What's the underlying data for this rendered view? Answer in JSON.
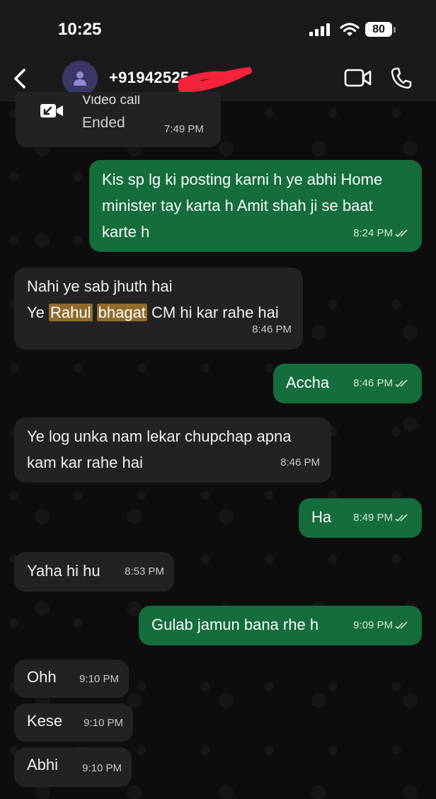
{
  "status_bar": {
    "time": "10:25",
    "battery": "80"
  },
  "header": {
    "contact": "+91942525"
  },
  "call": {
    "title": "Video call",
    "status": "Ended",
    "time": "7:49 PM"
  },
  "messages": [
    {
      "dir": "out",
      "lines": [
        "Kis sp lg ki posting karni h ye abhi Home",
        "minister tay karta h Amit shah ji se baat",
        "karte h"
      ],
      "time": "8:24 PM"
    },
    {
      "dir": "in",
      "line1": "Nahi ye sab jhuth hai",
      "line2_pre": "Ye ",
      "hl1": "Rahul",
      "hl2": "bhagat",
      "line2_post": " CM hi kar rahe hai",
      "time": "8:46 PM"
    },
    {
      "dir": "out",
      "text": "Accha",
      "time": "8:46 PM"
    },
    {
      "dir": "in",
      "lines": [
        "Ye log unka nam lekar chupchap apna",
        "kam kar rahe hai"
      ],
      "time": "8:46 PM"
    },
    {
      "dir": "out",
      "text": "Ha",
      "time": "8:49 PM"
    },
    {
      "dir": "in",
      "text": "Yaha hi hu",
      "time": "8:53 PM"
    },
    {
      "dir": "out",
      "text": "Gulab jamun bana rhe h",
      "time": "9:09 PM"
    },
    {
      "dir": "in",
      "text": "Ohh",
      "time": "9:10 PM"
    },
    {
      "dir": "in",
      "text": "Kese",
      "time": "9:10 PM"
    },
    {
      "dir": "in",
      "text": "Abhi",
      "time": "9:10 PM"
    }
  ]
}
